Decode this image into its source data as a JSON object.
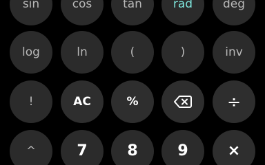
{
  "theme": {
    "background": "#000000",
    "key_fill": "#2b2b2b",
    "text_primary": "#ffffff",
    "text_secondary": "#b8b8b8",
    "accent": "#7fe6dd"
  },
  "keypad": {
    "row1": [
      {
        "label": "sin"
      },
      {
        "label": "cos"
      },
      {
        "label": "tan"
      },
      {
        "label": "rad"
      },
      {
        "label": "deg"
      }
    ],
    "row2": [
      {
        "label": "log"
      },
      {
        "label": "ln"
      },
      {
        "label": "("
      },
      {
        "label": ")"
      },
      {
        "label": "inv"
      }
    ],
    "row3": [
      {
        "label": "!"
      },
      {
        "label": "AC"
      },
      {
        "label": "%"
      },
      {
        "icon": "backspace-icon"
      },
      {
        "label": "÷"
      }
    ],
    "row4": [
      {
        "label": "^"
      },
      {
        "label": "7"
      },
      {
        "label": "8"
      },
      {
        "label": "9"
      },
      {
        "label": "×"
      }
    ]
  }
}
